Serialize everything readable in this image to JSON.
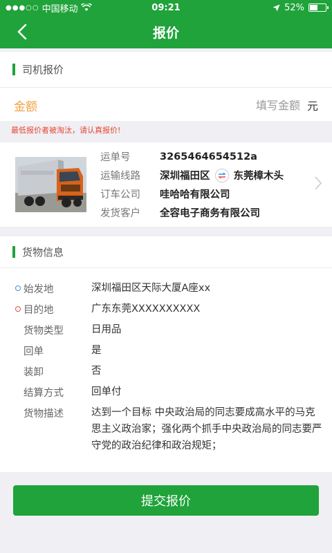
{
  "status_bar": {
    "carrier": "中国移动",
    "time": "09:21",
    "battery": "52%",
    "battery_level": 0.52
  },
  "nav": {
    "title": "报价"
  },
  "driver_quote": {
    "section_title": "司机报价",
    "amount_label": "金额",
    "amount_placeholder": "填写金额",
    "amount_value": "",
    "unit": "元",
    "warning": "最低报价者被淘汰，请认真报价!"
  },
  "order": {
    "waybill_label": "运单号",
    "waybill_value": "3265464654512a",
    "route_label": "运输线路",
    "route_from": "深圳福田区",
    "route_to": "东莞樟木头",
    "company_label": "订车公司",
    "company_value": "哇哈哈有限公司",
    "customer_label": "发货客户",
    "customer_value": "全容电子商务有限公司"
  },
  "goods": {
    "section_title": "货物信息",
    "rows": [
      {
        "label": "始发地",
        "value": "深圳福田区天际大厦A座xx"
      },
      {
        "label": "目的地",
        "value": "广东东莞XXXXXXXXXX"
      },
      {
        "label": "货物类型",
        "value": "日用品"
      },
      {
        "label": "回单",
        "value": "是"
      },
      {
        "label": "装卸",
        "value": "否"
      },
      {
        "label": "结算方式",
        "value": "回单付"
      },
      {
        "label": "货物描述",
        "value": "达到一个目标 中央政治局的同志要成高水平的马克思主义政治家；强化两个抓手中央政治局的同志要严守党的政治纪律和政治规矩；"
      }
    ]
  },
  "submit_label": "提交报价",
  "colors": {
    "primary": "#1fa33a",
    "amount_label": "#f0a040",
    "warning": "#e8452f",
    "origin_dot": "#3a8fe0",
    "destination_dot": "#e84a3a"
  },
  "icons": {
    "back": "chevron-left-icon",
    "route": "swap-arrows-icon",
    "chevron": "chevron-right-icon",
    "truck": "truck-image"
  }
}
